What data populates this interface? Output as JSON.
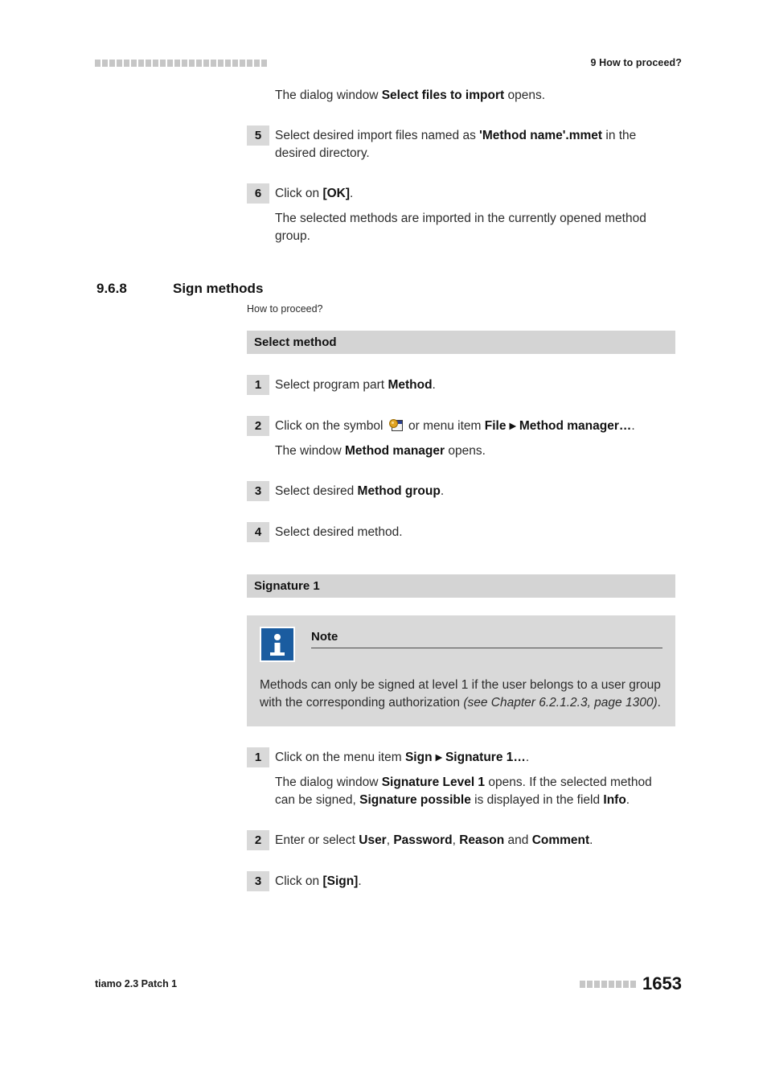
{
  "header": {
    "decoration_squares": 24,
    "title": "9 How to proceed?"
  },
  "intro": {
    "text_before": "The dialog window ",
    "bold": "Select files to import",
    "text_after": " opens."
  },
  "top_steps": [
    {
      "number": "5",
      "parts": [
        {
          "t": "Select desired import files named as ",
          "b": false
        },
        {
          "t": "'Method name'.mmet",
          "b": true
        },
        {
          "t": " in the desired directory.",
          "b": false
        }
      ]
    },
    {
      "number": "6",
      "parts": [
        {
          "t": "Click on ",
          "b": false
        },
        {
          "t": "[OK]",
          "b": true
        },
        {
          "t": ".",
          "b": false
        }
      ],
      "follow_up": "The selected methods are imported in the currently opened method group."
    }
  ],
  "section": {
    "number": "9.6.8",
    "title": "Sign methods",
    "subtitle": "How to proceed?"
  },
  "blocks": [
    {
      "heading": "Select method",
      "steps": [
        {
          "number": "1",
          "parts": [
            {
              "t": "Select program part ",
              "b": false
            },
            {
              "t": "Method",
              "b": true
            },
            {
              "t": ".",
              "b": false
            }
          ]
        },
        {
          "number": "2",
          "icon": "method-manager-icon",
          "parts": [
            {
              "t": "Click on the symbol ",
              "b": false
            },
            {
              "t": "ICON",
              "b": false
            },
            {
              "t": " or menu item ",
              "b": false
            },
            {
              "t": "File",
              "b": true
            },
            {
              "t": " ▸ ",
              "b": true
            },
            {
              "t": "Method manager…",
              "b": true
            },
            {
              "t": ".",
              "b": false
            }
          ],
          "follow_up_parts": [
            {
              "t": "The window ",
              "b": false
            },
            {
              "t": "Method manager",
              "b": true
            },
            {
              "t": " opens.",
              "b": false
            }
          ]
        },
        {
          "number": "3",
          "parts": [
            {
              "t": "Select desired ",
              "b": false
            },
            {
              "t": "Method group",
              "b": true
            },
            {
              "t": ".",
              "b": false
            }
          ]
        },
        {
          "number": "4",
          "parts": [
            {
              "t": "Select desired method.",
              "b": false
            }
          ]
        }
      ]
    },
    {
      "heading": "Signature 1",
      "note": {
        "icon": "info-icon",
        "title": "Note",
        "body_parts": [
          {
            "t": "Methods can only be signed at level 1 if the user belongs to a user group with the corresponding authorization ",
            "i": false
          },
          {
            "t": "(see Chapter 6.2.1.2.3, page 1300)",
            "i": true
          },
          {
            "t": ".",
            "i": false
          }
        ]
      },
      "steps": [
        {
          "number": "1",
          "parts": [
            {
              "t": "Click on the menu item ",
              "b": false
            },
            {
              "t": "Sign",
              "b": true
            },
            {
              "t": " ▸ ",
              "b": true
            },
            {
              "t": "Signature 1…",
              "b": true
            },
            {
              "t": ".",
              "b": false
            }
          ],
          "follow_up_parts": [
            {
              "t": "The dialog window ",
              "b": false
            },
            {
              "t": "Signature Level 1",
              "b": true
            },
            {
              "t": " opens. If the selected method can be signed, ",
              "b": false
            },
            {
              "t": "Signature possible",
              "b": true
            },
            {
              "t": " is displayed in the field ",
              "b": false
            },
            {
              "t": "Info",
              "b": true
            },
            {
              "t": ".",
              "b": false
            }
          ]
        },
        {
          "number": "2",
          "parts": [
            {
              "t": "Enter or select ",
              "b": false
            },
            {
              "t": "User",
              "b": true
            },
            {
              "t": ", ",
              "b": false
            },
            {
              "t": "Password",
              "b": true
            },
            {
              "t": ", ",
              "b": false
            },
            {
              "t": "Reason",
              "b": true
            },
            {
              "t": " and ",
              "b": false
            },
            {
              "t": "Comment",
              "b": true
            },
            {
              "t": ".",
              "b": false
            }
          ]
        },
        {
          "number": "3",
          "parts": [
            {
              "t": "Click on ",
              "b": false
            },
            {
              "t": "[Sign]",
              "b": true
            },
            {
              "t": ".",
              "b": false
            }
          ]
        }
      ]
    }
  ],
  "footer": {
    "product": "tiamo 2.3 Patch 1",
    "decoration_squares": 8,
    "page_number": "1653"
  },
  "colors": {
    "bar_gray": "#d4d4d4",
    "badge_gray": "#d9d9d9",
    "note_gray": "#d9d9d9",
    "info_blue": "#1a5ca0",
    "square_gray": "#c6c6c6"
  }
}
